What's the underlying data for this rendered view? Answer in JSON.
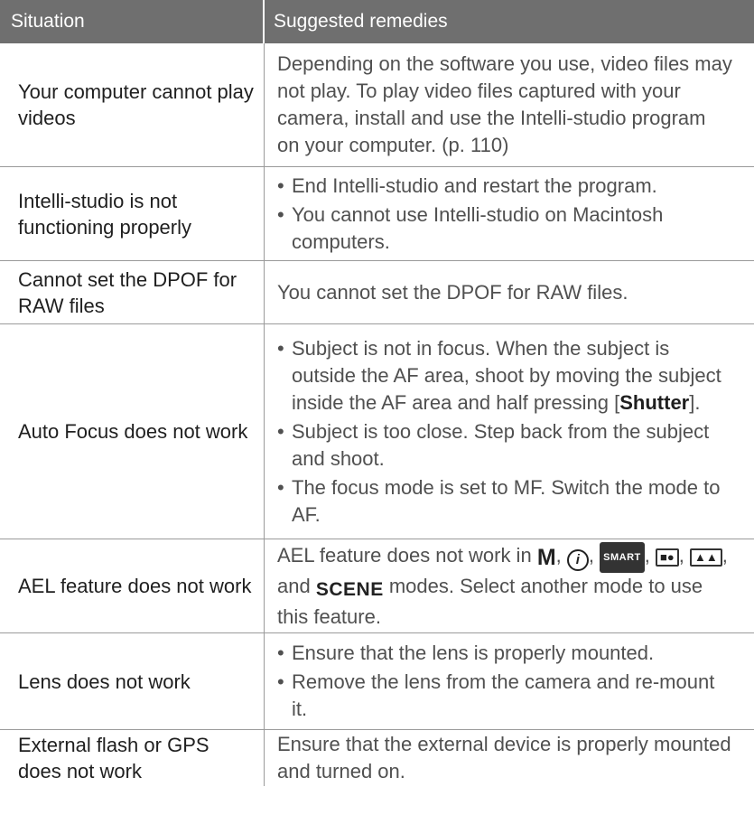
{
  "header": {
    "situation": "Situation",
    "remedies": "Suggested remedies"
  },
  "rows": [
    {
      "situation": "Your computer cannot play videos",
      "remedy": "Depending on the software you use, video files may not play. To play video files captured with your camera, install and use the Intelli-studio program on your computer. (p. 110)"
    },
    {
      "situation": "Intelli-studio is not functioning properly",
      "bullets": [
        "End Intelli-studio and restart the program.",
        "You cannot use Intelli-studio on Macintosh computers."
      ]
    },
    {
      "situation": "Cannot set the DPOF for RAW files",
      "remedy": "You cannot set the DPOF for RAW files."
    },
    {
      "situation": "Auto Focus does not work",
      "bullets": [
        "Subject is not in focus. When the subject is outside the AF area, shoot by moving the subject inside the AF area and half pressing [",
        "Subject is too close. Step back from the subject and shoot.",
        "The focus mode is set to MF. Switch the mode to AF."
      ],
      "shutter_key": "Shutter",
      "shutter_suffix": "]."
    },
    {
      "situation": "AEL feature does not work",
      "remedy_prefix": "AEL feature does not work in",
      "mode_m": "M",
      "mode_i": "i",
      "mode_smart": "SMART",
      "mode_scene": "SCENE",
      "remedy_suffix": "modes. Select another mode to use this feature.",
      "sep": ",",
      "and": ", and"
    },
    {
      "situation": "Lens does not work",
      "bullets": [
        "Ensure that the lens is properly mounted.",
        "Remove the lens from the camera and re-mount it."
      ]
    },
    {
      "situation": "External flash or GPS does not work",
      "remedy": "Ensure that the external device is properly mounted and turned on."
    }
  ],
  "bullet_char": "•"
}
